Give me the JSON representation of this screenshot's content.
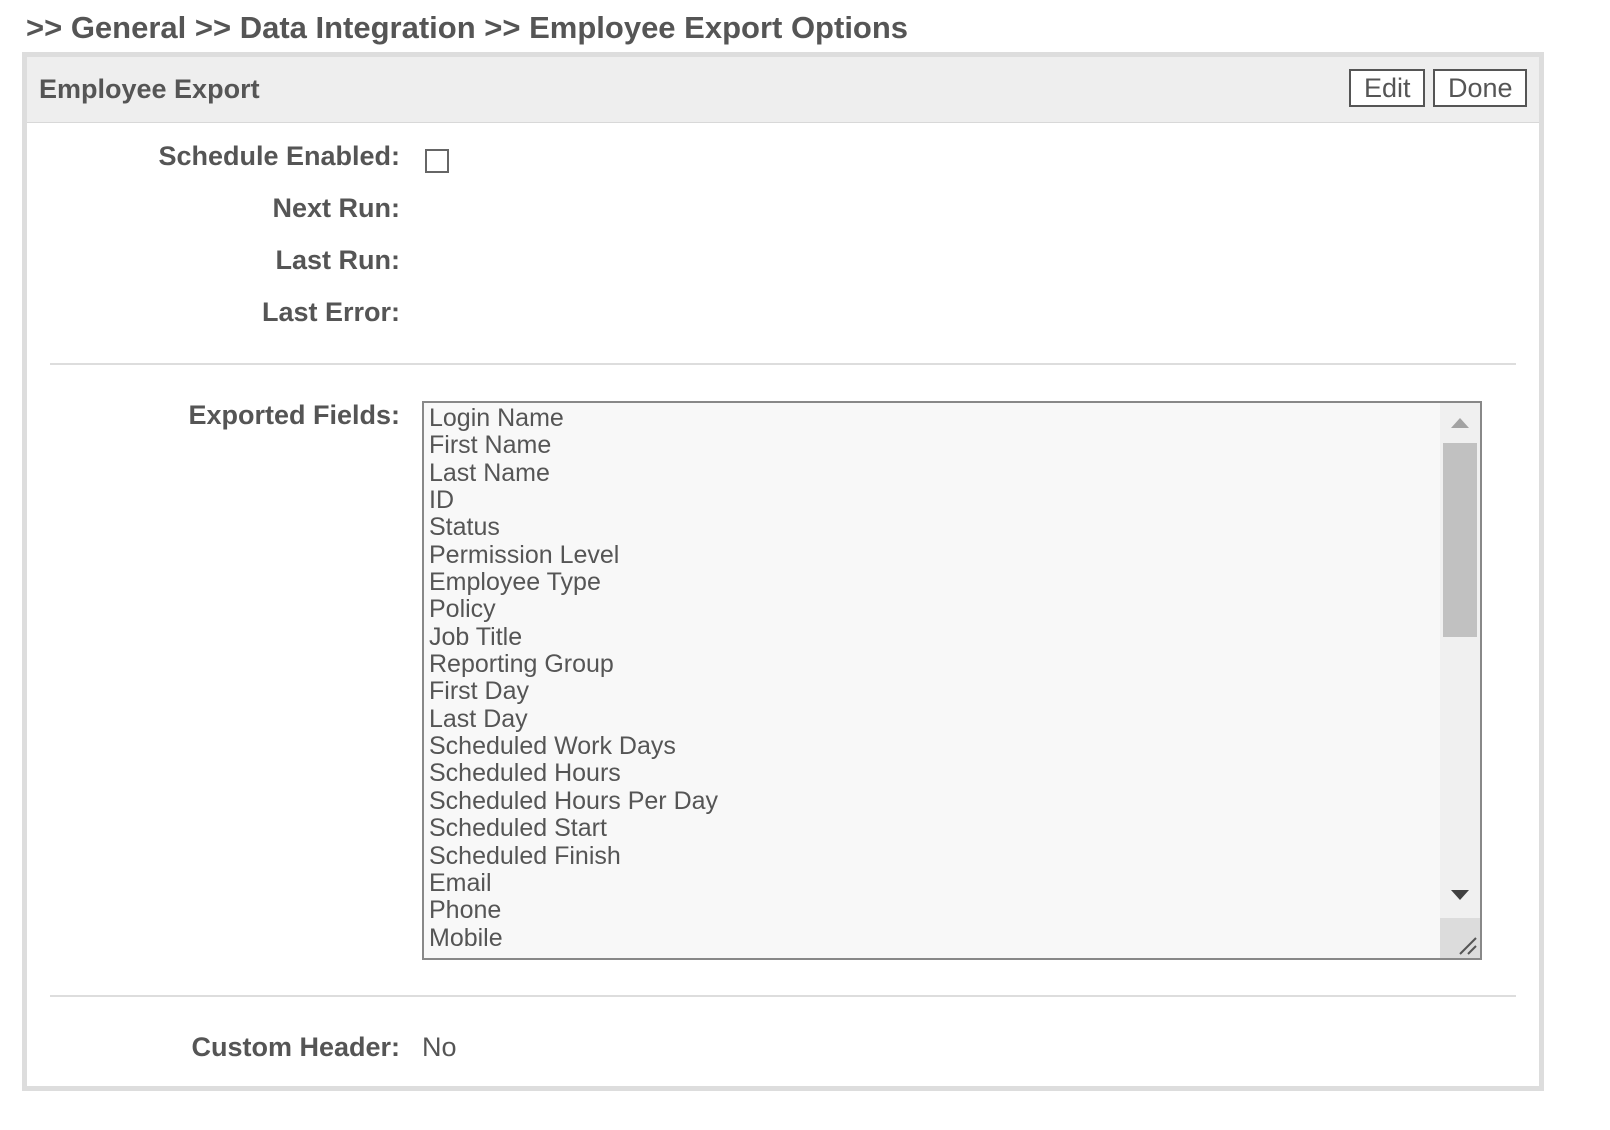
{
  "breadcrumb": ">> General >> Data Integration >> Employee Export Options",
  "panel": {
    "title": "Employee Export",
    "edit_label": "Edit",
    "done_label": "Done"
  },
  "fields": {
    "schedule_enabled_label": "Schedule Enabled:",
    "schedule_enabled_checked": false,
    "next_run_label": "Next Run:",
    "last_run_label": "Last Run:",
    "last_error_label": "Last Error:",
    "exported_fields_label": "Exported Fields:",
    "custom_header_label": "Custom Header:",
    "custom_header_value": "No"
  },
  "exported_fields": [
    "Login Name",
    "First Name",
    "Last Name",
    "ID",
    "Status",
    "Permission Level",
    "Employee Type",
    "Policy",
    "Job Title",
    "Reporting Group",
    "First Day",
    "Last Day",
    "Scheduled Work Days",
    "Scheduled Hours",
    "Scheduled Hours Per Day",
    "Scheduled Start",
    "Scheduled Finish",
    "Email",
    "Phone",
    "Mobile"
  ],
  "icons": {
    "scroll_up": "scroll-up-arrow-icon",
    "scroll_down": "scroll-down-arrow-icon",
    "resize": "resize-grip-icon"
  }
}
